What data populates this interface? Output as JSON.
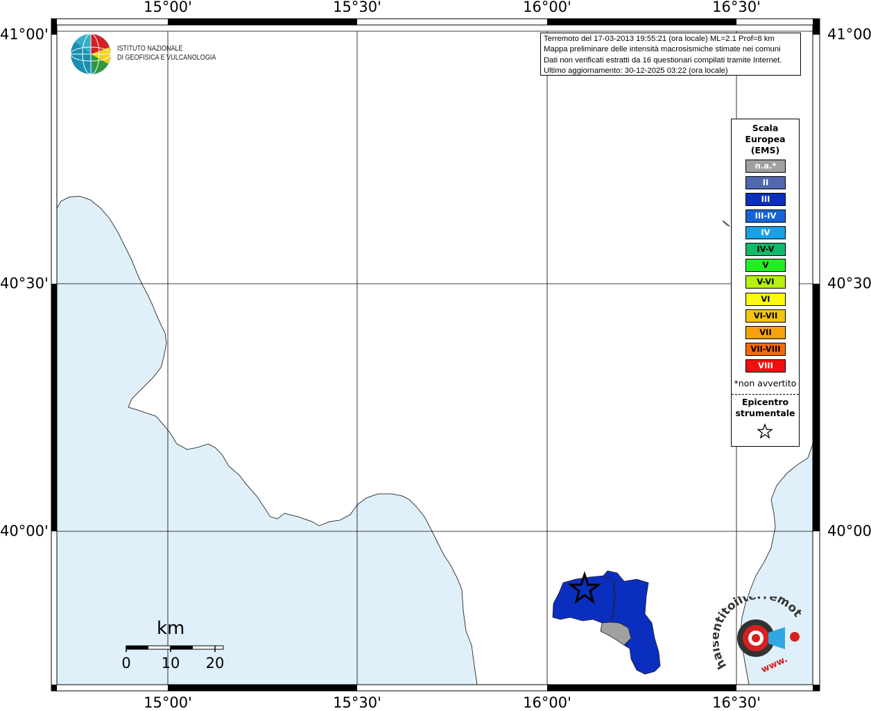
{
  "map": {
    "lon_labels": [
      "15°00'",
      "15°30'",
      "16°00'",
      "16°30'"
    ],
    "lat_labels": [
      "41°00'",
      "40°30'",
      "40°00'"
    ],
    "colors": {
      "sea": "#e0f0fb",
      "land": "#ffffff",
      "grid": "#000000",
      "intensity_III": "#0a2fbf",
      "not_felt": "#a0a0a0"
    }
  },
  "info": {
    "line1": "Terremoto del 17-03-2013 19:55:21 (ora locale) ML=2.1 Prof=8 km",
    "line2": "Mappa preliminare delle intensità macrosismiche stimate nei comuni",
    "line3": "Dati non verificati estratti da 16 questionari compilati tramite Internet.",
    "line4": "Ultimo aggiornamento: 30-12-2025 03:22 (ora locale)"
  },
  "ingv": {
    "line1": "ISTITUTO NAZIONALE",
    "line2": "DI GEOFISICA E VULCANOLOGIA"
  },
  "legend": {
    "title_line1": "Scala",
    "title_line2": "Europea",
    "title_line3": "(EMS)",
    "items": [
      {
        "label": "n.a.*",
        "color": "#a0a0a0",
        "text": "#ffffff"
      },
      {
        "label": "II",
        "color": "#5168b0",
        "text": "#ffffff"
      },
      {
        "label": "III",
        "color": "#0a2fbf",
        "text": "#ffffff"
      },
      {
        "label": "III-IV",
        "color": "#1565d8",
        "text": "#ffffff"
      },
      {
        "label": "IV",
        "color": "#1aa0e6",
        "text": "#ffffff"
      },
      {
        "label": "IV-V",
        "color": "#14b86a",
        "text": "#000000"
      },
      {
        "label": "V",
        "color": "#22ee22",
        "text": "#000000"
      },
      {
        "label": "V-VI",
        "color": "#b6ef10",
        "text": "#000000"
      },
      {
        "label": "VI",
        "color": "#fafa10",
        "text": "#000000"
      },
      {
        "label": "VI-VII",
        "color": "#f5c40e",
        "text": "#000000"
      },
      {
        "label": "VII",
        "color": "#f7a20c",
        "text": "#000000"
      },
      {
        "label": "VII-VIII",
        "color": "#f7690c",
        "text": "#000000"
      },
      {
        "label": "VIII",
        "color": "#f01010",
        "text": "#ffffff"
      }
    ],
    "note": "*non avvertito",
    "epicenter_line1": "Epicentro",
    "epicenter_line2": "strumentale"
  },
  "scale": {
    "unit": "km",
    "ticks": [
      "0",
      "10",
      "20"
    ]
  },
  "logo_hst": {
    "text": "haisentitoilterremoto.it",
    "www": "www."
  }
}
